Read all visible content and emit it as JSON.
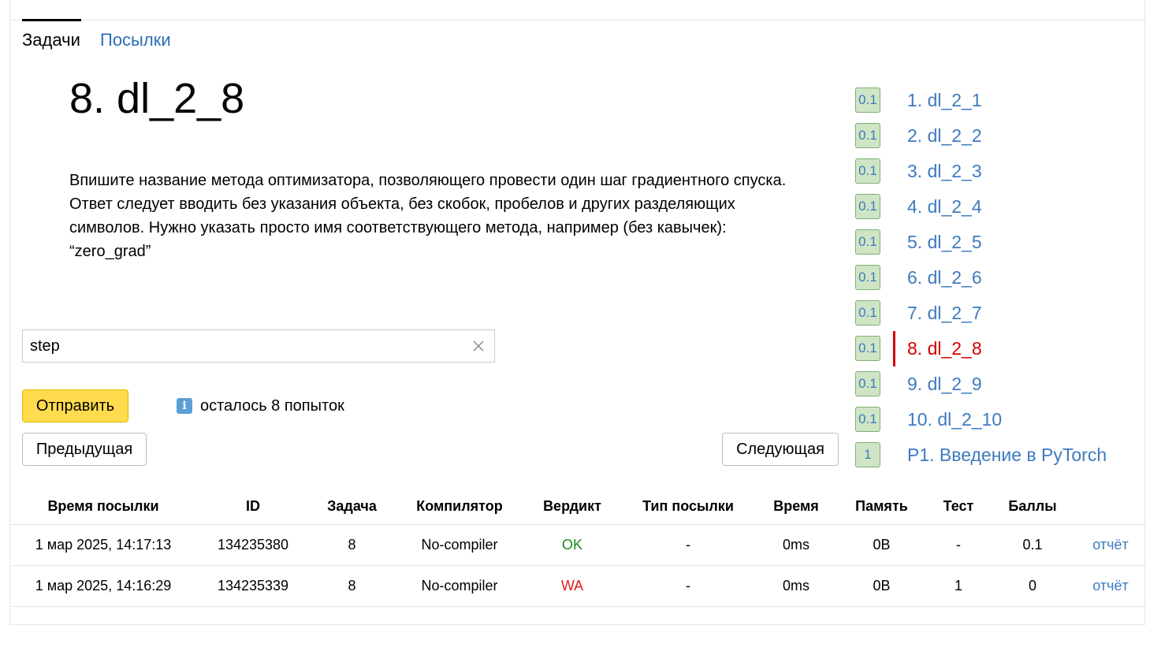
{
  "tabs": [
    {
      "label": "Задачи",
      "active": true
    },
    {
      "label": "Посылки",
      "active": false
    }
  ],
  "problem": {
    "title": "8. dl_2_8",
    "statement": "Впишите название метода оптимизатора, позволяющего провести один шаг градиентного спуска. Ответ следует вводить без указания объекта, без скобок, пробелов и других разделяющих символов. Нужно указать просто имя соответствующего метода, например (без кавычек): “zero_grad”"
  },
  "answer": {
    "value": "step",
    "placeholder": ""
  },
  "buttons": {
    "submit": "Отправить",
    "prev": "Предыдущая",
    "next": "Следующая"
  },
  "attempts_text": "осталось 8 попыток",
  "problem_list": [
    {
      "score": "0.1",
      "label": "1. dl_2_1",
      "active": false
    },
    {
      "score": "0.1",
      "label": "2. dl_2_2",
      "active": false
    },
    {
      "score": "0.1",
      "label": "3. dl_2_3",
      "active": false
    },
    {
      "score": "0.1",
      "label": "4. dl_2_4",
      "active": false
    },
    {
      "score": "0.1",
      "label": "5. dl_2_5",
      "active": false
    },
    {
      "score": "0.1",
      "label": "6. dl_2_6",
      "active": false
    },
    {
      "score": "0.1",
      "label": "7. dl_2_7",
      "active": false
    },
    {
      "score": "0.1",
      "label": "8. dl_2_8",
      "active": true
    },
    {
      "score": "0.1",
      "label": "9. dl_2_9",
      "active": false
    },
    {
      "score": "0.1",
      "label": "10. dl_2_10",
      "active": false
    },
    {
      "score": "1",
      "label": "P1. Введение в PyTorch",
      "active": false
    }
  ],
  "submissions": {
    "headers": [
      "Время посылки",
      "ID",
      "Задача",
      "Компилятор",
      "Вердикт",
      "Тип посылки",
      "Время",
      "Память",
      "Тест",
      "Баллы",
      ""
    ],
    "rows": [
      {
        "time": "1 мар 2025, 14:17:13",
        "id": "134235380",
        "task": "8",
        "compiler": "No-compiler",
        "verdict": "OK",
        "type": "-",
        "runtime": "0ms",
        "memory": "0B",
        "test": "-",
        "score": "0.1",
        "report": "отчёт"
      },
      {
        "time": "1 мар 2025, 14:16:29",
        "id": "134235339",
        "task": "8",
        "compiler": "No-compiler",
        "verdict": "WA",
        "type": "-",
        "runtime": "0ms",
        "memory": "0B",
        "test": "1",
        "score": "0",
        "report": "отчёт"
      }
    ]
  },
  "colors": {
    "accent": "#ffdb4d",
    "link": "#3e7bbf",
    "active": "#d40000",
    "ok": "#1a8a1a",
    "wa": "#e01b1b"
  }
}
